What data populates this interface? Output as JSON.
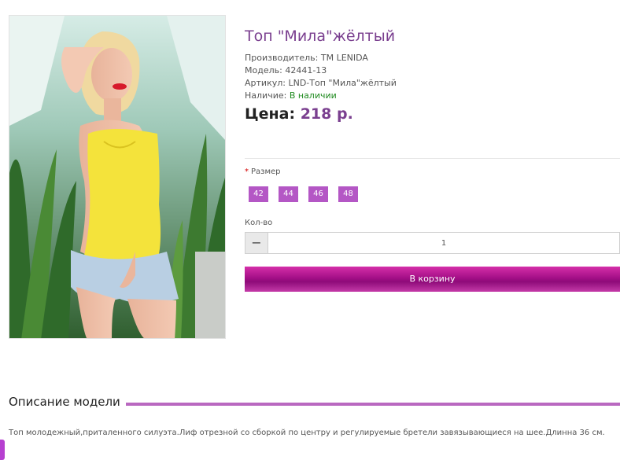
{
  "product": {
    "title": "Топ \"Мила\"жёлтый",
    "image_alt": "Фото модели в жёлтом топе",
    "manufacturer_label": "Производитель:",
    "manufacturer": "TM LENIDA",
    "model_label": "Модель:",
    "model": "42441-13",
    "article_label": "Артикул:",
    "article": "LND-Топ \"Мила\"жёлтый",
    "availability_label": "Наличие:",
    "availability": "В наличии",
    "price_label": "Цена:",
    "price": "218 р."
  },
  "options": {
    "size_label": "Размер",
    "required_mark": "*",
    "sizes": [
      "42",
      "44",
      "46",
      "48"
    ]
  },
  "quantity": {
    "label": "Кол-во",
    "minus": "−",
    "value": "1"
  },
  "cart_button": "В корзину",
  "description": {
    "heading": "Описание модели",
    "text": "Топ молодежный,приталенного силуэта.Лиф отрезной со сборкой по центру и регулируемые бретели завязывающиеся на шее.Длинна 36 см."
  },
  "colors": {
    "accent": "#7a3f8f",
    "size_button": "#b457c5",
    "in_stock": "#1f8a1f",
    "cart_button": "#a40f87",
    "divider_accent": "#b968c0"
  }
}
